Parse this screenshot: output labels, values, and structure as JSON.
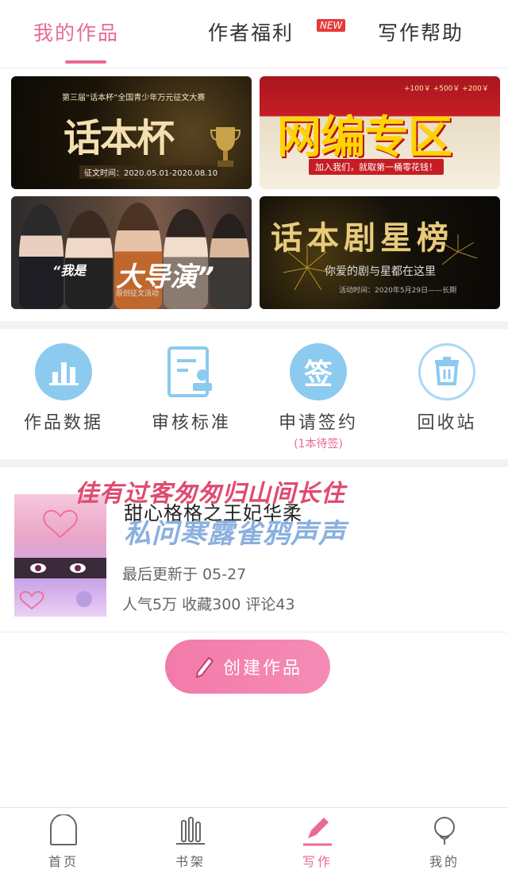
{
  "top_tabs": [
    {
      "label": "我的作品",
      "active": true
    },
    {
      "label": "作者福利",
      "badge": "NEW"
    },
    {
      "label": "写作帮助"
    }
  ],
  "banners": [
    {
      "top": "第三届“话本杯”全国青少年万元征文大赛",
      "title": "话本杯",
      "date": "征文时间：2020.05.01-2020.08.10"
    },
    {
      "title": "网编专区",
      "sub": "加入我们，就取第一桶零花钱！",
      "money": "+100￥  +500￥  +200￥"
    },
    {
      "prefix": "“我是",
      "title": "大导演”",
      "sub": "原创征文活动"
    },
    {
      "title": "话本剧星榜",
      "sub": "你爱的剧与星都在这里",
      "date": "活动时间：2020年5月29日——长期"
    }
  ],
  "tools": [
    {
      "label": "作品数据",
      "icon": "chart-bars-icon"
    },
    {
      "label": "审核标准",
      "icon": "document-stamp-icon"
    },
    {
      "label": "申请签约",
      "icon": "sign-badge-icon",
      "icon_text": "签",
      "sub": "(1本待签)"
    },
    {
      "label": "回收站",
      "icon": "trash-icon"
    }
  ],
  "work": {
    "stamp_top": "佳有过客匆匆归山间长住",
    "title": "甜心格格之王妃华柔",
    "stamp_blue": "私问寒露雀鸦声声",
    "updated": "最后更新于 05-27",
    "stats": "人气5万 收藏300 评论43"
  },
  "create_button": "创建作品",
  "bottom_nav": [
    {
      "label": "首页",
      "icon": "home-icon"
    },
    {
      "label": "书架",
      "icon": "bookshelf-icon"
    },
    {
      "label": "写作",
      "icon": "pen-icon",
      "active": true
    },
    {
      "label": "我的",
      "icon": "profile-icon"
    }
  ],
  "colors": {
    "accent": "#e96a93",
    "tool_icon_blue": "#8ccaf0",
    "badge_red": "#e53b3b"
  }
}
